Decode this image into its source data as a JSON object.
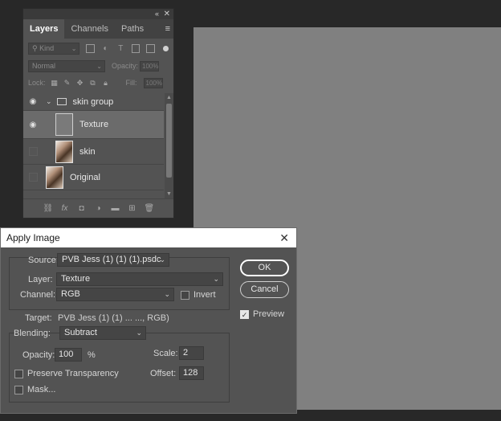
{
  "layers_panel": {
    "tabs": [
      "Layers",
      "Channels",
      "Paths"
    ],
    "filter_kind": "Kind",
    "blend_mode": "Normal",
    "opacity_label": "Opacity:",
    "opacity_value": "100%",
    "lock_label": "Lock:",
    "fill_label": "Fill:",
    "fill_value": "100%",
    "layers": [
      {
        "name": "skin group",
        "type": "group",
        "visible": true
      },
      {
        "name": "Texture",
        "type": "layer",
        "visible": true,
        "selected": true
      },
      {
        "name": "skin",
        "type": "layer",
        "visible": false
      },
      {
        "name": "Original",
        "type": "layer",
        "visible": false
      }
    ]
  },
  "dialog": {
    "title": "Apply Image",
    "source_label": "Source:",
    "source_value": "PVB Jess (1) (1) (1).psdc",
    "layer_label": "Layer:",
    "layer_value": "Texture",
    "channel_label": "Channel:",
    "channel_value": "RGB",
    "invert_label": "Invert",
    "invert_checked": false,
    "target_label": "Target:",
    "target_value": "PVB Jess (1) (1) ... ..., RGB)",
    "blending_label": "Blending:",
    "blending_value": "Subtract",
    "opacity_label": "Opacity:",
    "opacity_value": "100",
    "opacity_unit": "%",
    "scale_label": "Scale:",
    "scale_value": "2",
    "offset_label": "Offset:",
    "offset_value": "128",
    "preserve_label": "Preserve Transparency",
    "mask_label": "Mask...",
    "ok_label": "OK",
    "cancel_label": "Cancel",
    "preview_label": "Preview",
    "preview_checked": true
  },
  "colors": {
    "canvas": "#808080",
    "panel": "#535353",
    "app_background": "#282828"
  }
}
